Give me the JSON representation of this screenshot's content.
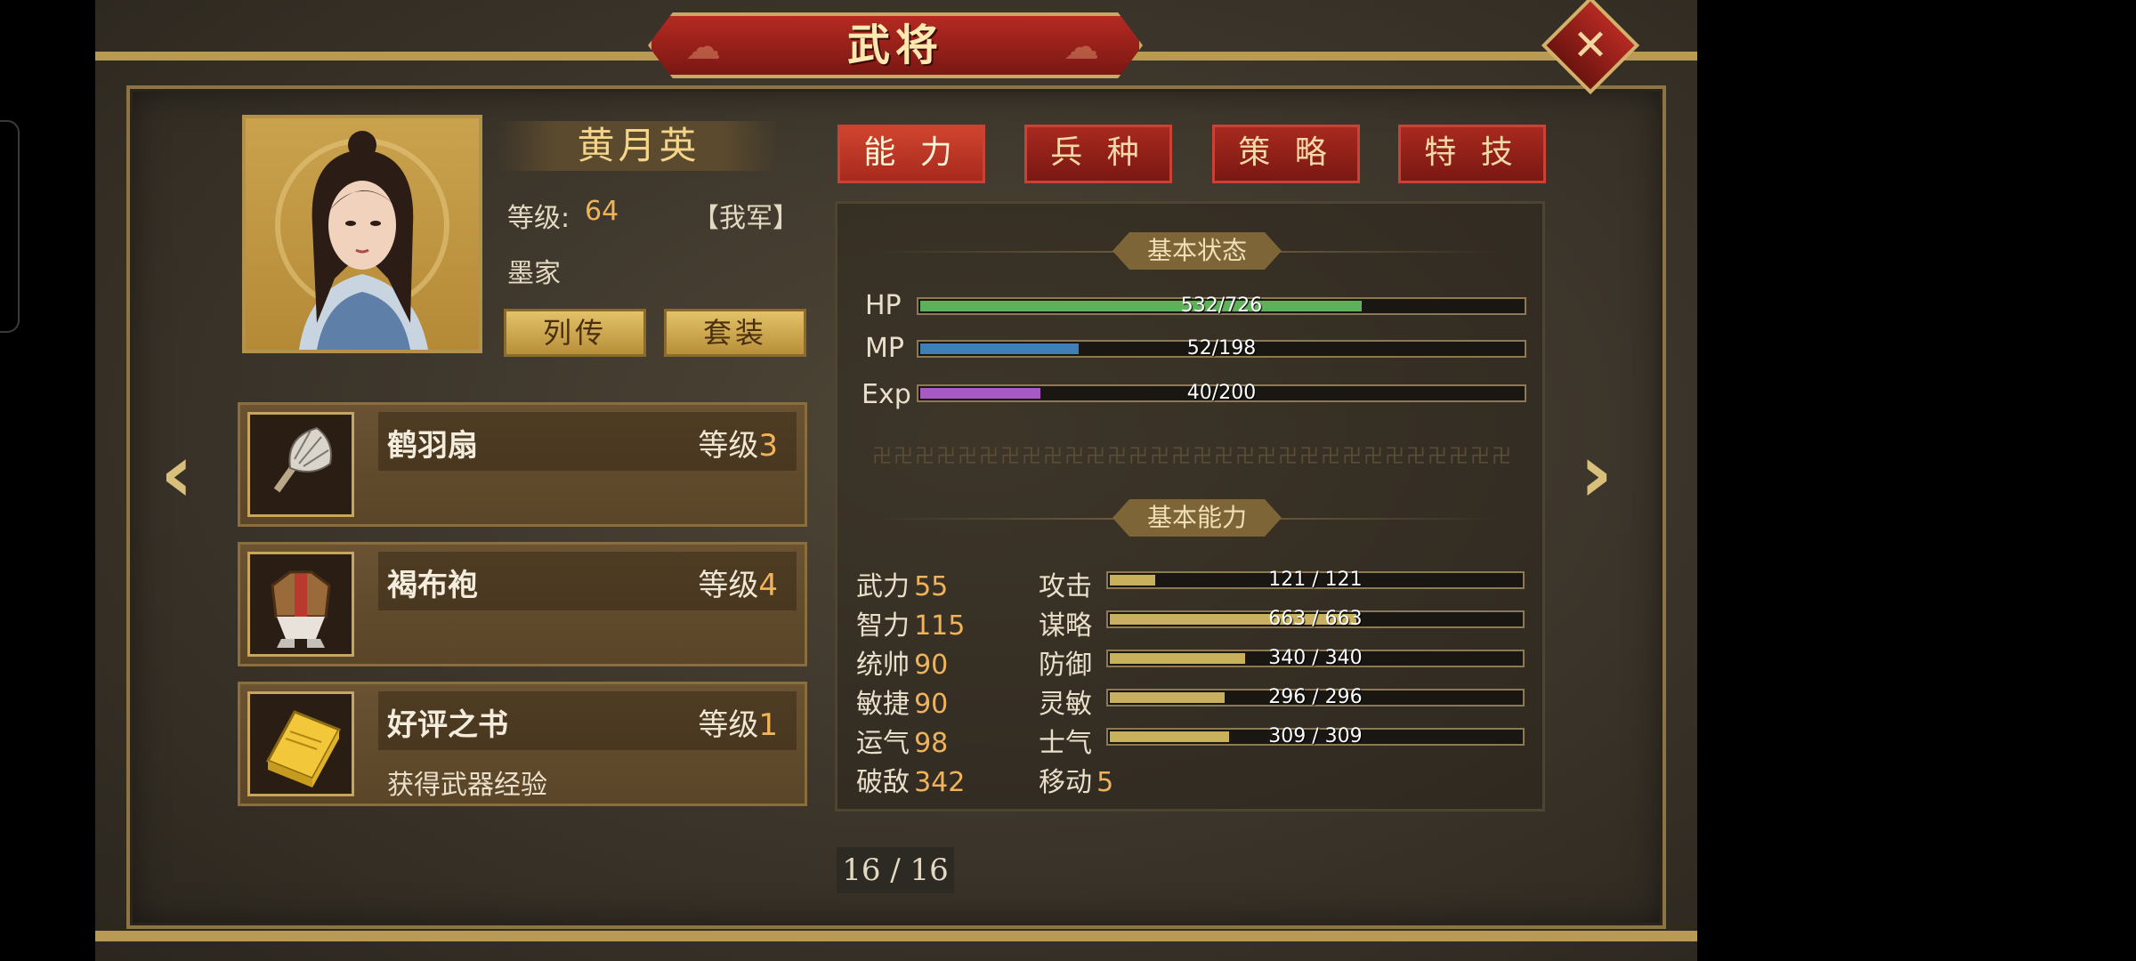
{
  "title": "武将",
  "general": {
    "name": "黄月英",
    "level_label": "等级:",
    "level_value": "64",
    "faction": "【我军】",
    "class": "墨家",
    "btn_biography": "列传",
    "btn_set": "套装"
  },
  "equipment": [
    {
      "name": "鹤羽扇",
      "level_label": "等级",
      "level": "3",
      "desc": "",
      "icon": "feather-fan-icon"
    },
    {
      "name": "褐布袍",
      "level_label": "等级",
      "level": "4",
      "desc": "",
      "icon": "robe-icon"
    },
    {
      "name": "好评之书",
      "level_label": "等级",
      "level": "1",
      "desc": "获得武器经验",
      "icon": "book-icon"
    }
  ],
  "tabs": [
    "能 力",
    "兵 种",
    "策 略",
    "特 技"
  ],
  "status": {
    "section_title": "基本状态",
    "bars": [
      {
        "label": "HP",
        "text": "532/726",
        "fill": 0.733,
        "color": "#5fb05a"
      },
      {
        "label": "MP",
        "text": "52/198",
        "fill": 0.263,
        "color": "#3f7fb4"
      },
      {
        "label": "Exp",
        "text": "40/200",
        "fill": 0.2,
        "color": "#a75ac4"
      }
    ]
  },
  "ability": {
    "section_title": "基本能力",
    "left": [
      {
        "name": "武力",
        "value": "55"
      },
      {
        "name": "智力",
        "value": "115"
      },
      {
        "name": "统帅",
        "value": "90"
      },
      {
        "name": "敏捷",
        "value": "90"
      },
      {
        "name": "运气",
        "value": "98"
      },
      {
        "name": "破敌",
        "value": "342"
      }
    ],
    "right": [
      {
        "name": "攻击",
        "text": "121 / 121",
        "fill": 0.11
      },
      {
        "name": "谋略",
        "text": "663 / 663",
        "fill": 0.6
      },
      {
        "name": "防御",
        "text": "340 / 340",
        "fill": 0.33
      },
      {
        "name": "灵敏",
        "text": "296 / 296",
        "fill": 0.28
      },
      {
        "name": "士气",
        "text": "309 / 309",
        "fill": 0.29
      }
    ],
    "move_label": "移动",
    "move_value": "5"
  },
  "page_indicator": "16 / 16",
  "colors": {
    "accent_red": "#a8291f",
    "gold": "#f0b35a",
    "bar_gold": "#c9b05c"
  }
}
